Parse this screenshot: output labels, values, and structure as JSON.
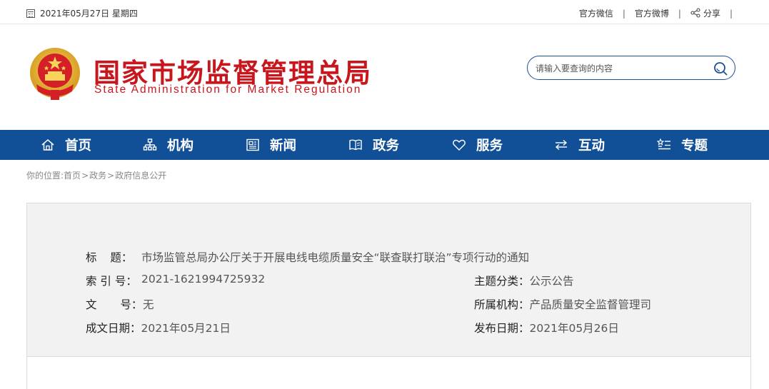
{
  "topbar": {
    "date": "2021年05月27日 星期四",
    "links": [
      {
        "label": "官方微信"
      },
      {
        "label": "官方微博"
      },
      {
        "label": "分享"
      }
    ],
    "separator": "|"
  },
  "header": {
    "title_cn": "国家市场监督管理总局",
    "title_en": "State Administration for Market Regulation",
    "search_placeholder": "请输入要查询的内容"
  },
  "nav": {
    "items": [
      {
        "label": "首页",
        "icon": "home-icon"
      },
      {
        "label": "机构",
        "icon": "org-chart-icon"
      },
      {
        "label": "新闻",
        "icon": "news-icon"
      },
      {
        "label": "政务",
        "icon": "book-icon"
      },
      {
        "label": "服务",
        "icon": "heart-icon"
      },
      {
        "label": "互动",
        "icon": "swap-arrows-icon"
      },
      {
        "label": "专题",
        "icon": "star-list-icon"
      }
    ]
  },
  "breadcrumb": {
    "prefix": "你的位置:",
    "items": [
      "首页",
      "政务",
      "政府信息公开"
    ],
    "arrow": ">"
  },
  "info": {
    "title_label": "标 题：",
    "title_value": "市场监管总局办公厅关于开展电线电缆质量安全“联查联打联治”专项行动的通知",
    "index_label": "索 引 号：",
    "index_value": "2021-1621994725932",
    "topic_label": "主题分类：",
    "topic_value": "公示公告",
    "docno_label": "文 号：",
    "docno_value": "无",
    "org_label": "所属机构：",
    "org_value": "产品质量安全监督管理司",
    "written_label": "成文日期：",
    "written_value": "2021年05月21日",
    "published_label": "发布日期：",
    "published_value": "2021年05月26日"
  },
  "colors": {
    "brand_red": "#c8161d",
    "nav_blue": "#114f96",
    "panel_bg": "#f2f2f2"
  }
}
